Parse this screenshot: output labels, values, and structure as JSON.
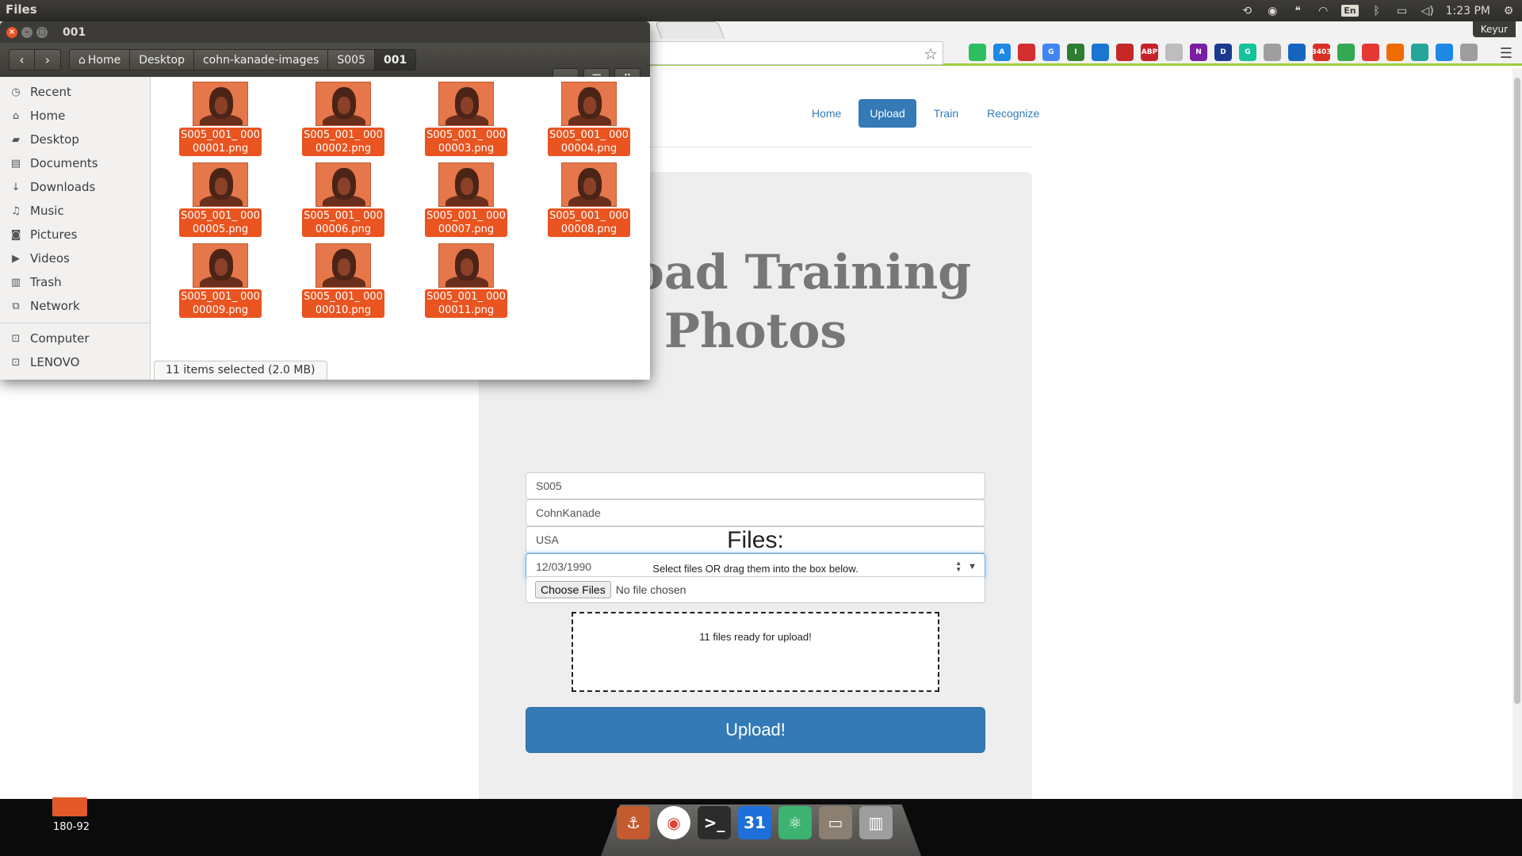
{
  "top_panel": {
    "app_title": "Files",
    "lang": "En",
    "clock": "1:23 PM"
  },
  "browser": {
    "user_tab": "Keyur",
    "nav": {
      "home": "Home",
      "upload": "Upload",
      "train": "Train",
      "recognize": "Recognize"
    },
    "heading": "Upload Training Photos",
    "heading_visible": "load Training Photos",
    "form": {
      "name_value": "S005",
      "database_value": "CohnKanade",
      "country_value": "USA",
      "date_value": "12/03/1990"
    },
    "files_heading": "Files:",
    "files_hint": "Select files OR drag them into the box below.",
    "choose_files_label": "Choose Files",
    "no_file_text": "No file chosen",
    "dropzone_text": "11 files ready for upload!",
    "upload_button": "Upload!",
    "extensions": [
      {
        "name": "evernote-ext",
        "color": "#2dbe60",
        "text": ""
      },
      {
        "name": "drive-ext",
        "color": "#1e88e5",
        "text": "A"
      },
      {
        "name": "bookmark-ext",
        "color": "#d32f2f",
        "text": ""
      },
      {
        "name": "translate-ext",
        "color": "#4285f4",
        "text": "G"
      },
      {
        "name": "ext-i",
        "color": "#2e7d32",
        "text": "I"
      },
      {
        "name": "tab-ext",
        "color": "#1976d2",
        "text": ""
      },
      {
        "name": "car-ext",
        "color": "#c62828",
        "text": ""
      },
      {
        "name": "adblock-plus-ext",
        "color": "#c7222a",
        "text": "ABP"
      },
      {
        "name": "ext-grey",
        "color": "#bdbdbd",
        "text": ""
      },
      {
        "name": "onenote-ext",
        "color": "#7b1fa2",
        "text": "N"
      },
      {
        "name": "ext-d",
        "color": "#1a3a8f",
        "text": "D"
      },
      {
        "name": "grammarly-ext",
        "color": "#15c39a",
        "text": "G"
      },
      {
        "name": "ext-circle",
        "color": "#9e9e9e",
        "text": ""
      },
      {
        "name": "stack-ext",
        "color": "#1565c0",
        "text": ""
      },
      {
        "name": "gmail-ext",
        "color": "#d93025",
        "text": "3403"
      },
      {
        "name": "gdrive-ext",
        "color": "#34a853",
        "text": ""
      },
      {
        "name": "pin-ext",
        "color": "#e53935",
        "text": ""
      },
      {
        "name": "carrot-ext",
        "color": "#ef6c00",
        "text": ""
      },
      {
        "name": "ext-shape",
        "color": "#26a69a",
        "text": ""
      },
      {
        "name": "send-ext",
        "color": "#1e88e5",
        "text": ""
      },
      {
        "name": "screenshot-ext",
        "color": "#9e9e9e",
        "text": ""
      }
    ]
  },
  "files_window": {
    "title": "001",
    "breadcrumbs": [
      "Home",
      "Desktop",
      "cohn-kanade-images",
      "S005",
      "001"
    ],
    "sidebar": [
      {
        "label": "Recent",
        "icon": "clock-icon",
        "glyph": "◷"
      },
      {
        "label": "Home",
        "icon": "home-icon",
        "glyph": "⌂"
      },
      {
        "label": "Desktop",
        "icon": "folder-icon",
        "glyph": "▰"
      },
      {
        "label": "Documents",
        "icon": "document-icon",
        "glyph": "▤"
      },
      {
        "label": "Downloads",
        "icon": "download-icon",
        "glyph": "↓"
      },
      {
        "label": "Music",
        "icon": "music-icon",
        "glyph": "♫"
      },
      {
        "label": "Pictures",
        "icon": "camera-icon",
        "glyph": "◙"
      },
      {
        "label": "Videos",
        "icon": "video-icon",
        "glyph": "▶"
      },
      {
        "label": "Trash",
        "icon": "trash-icon",
        "glyph": "▥"
      },
      {
        "label": "Network",
        "icon": "network-icon",
        "glyph": "⧉"
      }
    ],
    "devices": [
      {
        "label": "Computer",
        "icon": "drive-icon",
        "glyph": "⊡"
      },
      {
        "label": "LENOVO",
        "icon": "drive-icon",
        "glyph": "⊡"
      }
    ],
    "files": [
      "S005_001_ 00000001.png",
      "S005_001_ 00000002.png",
      "S005_001_ 00000003.png",
      "S005_001_ 00000004.png",
      "S005_001_ 00000005.png",
      "S005_001_ 00000006.png",
      "S005_001_ 00000007.png",
      "S005_001_ 00000008.png",
      "S005_001_ 00000009.png",
      "S005_001_ 00000010.png",
      "S005_001_ 00000011.png"
    ],
    "status": "11 items selected  (2.0 MB)"
  },
  "desktop": {
    "file_label": "180-92",
    "dock": [
      {
        "name": "anchor-app-icon",
        "color": "#c45a30",
        "glyph": "⚓"
      },
      {
        "name": "chrome-icon",
        "color": "#ffffff",
        "glyph": "◉"
      },
      {
        "name": "terminal-icon",
        "color": "#2c2c2c",
        "glyph": ">_"
      },
      {
        "name": "calendar-icon",
        "color": "#1e6fd9",
        "glyph": "31"
      },
      {
        "name": "atom-icon",
        "color": "#3cb371",
        "glyph": "⚛"
      },
      {
        "name": "files-dock-icon",
        "color": "#8a7f70",
        "glyph": "▭"
      },
      {
        "name": "dock-trash-icon",
        "color": "#9e9e9e",
        "glyph": "▥"
      }
    ]
  }
}
